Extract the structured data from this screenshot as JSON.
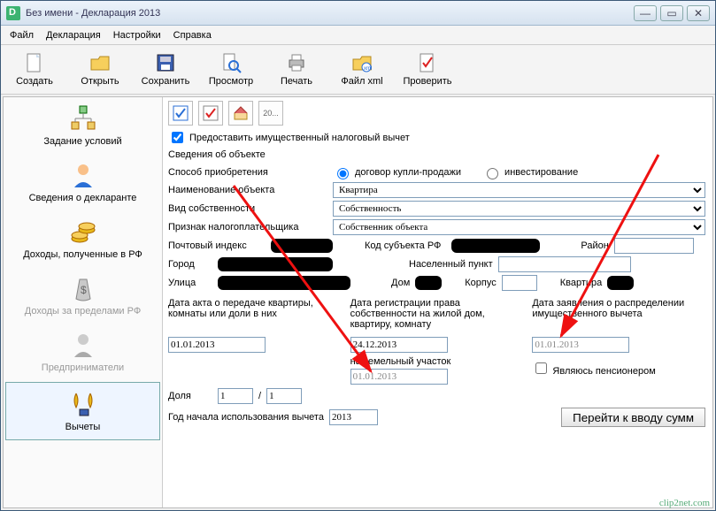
{
  "window": {
    "title": "Без имени - Декларация 2013"
  },
  "menu": {
    "file": "Файл",
    "decl": "Декларация",
    "settings": "Настройки",
    "help": "Справка"
  },
  "toolbar": {
    "create": "Создать",
    "open": "Открыть",
    "save": "Сохранить",
    "preview": "Просмотр",
    "print": "Печать",
    "xml": "Файл xml",
    "check": "Проверить"
  },
  "sidebar": {
    "conditions": "Задание условий",
    "declarant": "Сведения о декларанте",
    "income_rf": "Доходы, полученные в РФ",
    "income_foreign": "Доходы за пределами РФ",
    "entrepreneurs": "Предприниматели",
    "deductions": "Вычеты"
  },
  "content": {
    "grant_checkbox": "Предоставить имущественный налоговый вычет",
    "section_title": "Сведения об объекте",
    "labels": {
      "acq_method": "Способ приобретения",
      "obj_name": "Наименование объекта",
      "ownership_type": "Вид собственности",
      "taxpayer_sign": "Признак налогоплательщика",
      "postal": "Почтовый индекс",
      "subject_code": "Код субъекта РФ",
      "district": "Район",
      "city": "Город",
      "settlement": "Населенный пункт",
      "street": "Улица",
      "house": "Дом",
      "building": "Корпус",
      "flat": "Квартира",
      "date_act": "Дата акта о передаче квартиры, комнаты или доли в них",
      "date_reg": "Дата регистрации права собственности на жилой дом, квартиру, комнату",
      "land_sub": "на земельный участок",
      "date_appl": "Дата заявления о распределении имущественного вычета",
      "share": "Доля",
      "pensioner": "Являюсь пенсионером",
      "year_start": "Год начала использования вычета",
      "goto_sums": "Перейти к вводу сумм"
    },
    "radios": {
      "contract": "договор купли-продажи",
      "invest": "инвестирование"
    },
    "values": {
      "obj_name": "Квартира",
      "ownership_type": "Собственность",
      "taxpayer_sign": "Собственник объекта",
      "date_act": "01.01.2013",
      "date_reg": "24.12.2013",
      "date_land": "01.01.2013",
      "date_appl": "01.01.2013",
      "share_a": "1",
      "share_b": "1",
      "year_start": "2013"
    }
  },
  "subtoolbar": {
    "twenty": "20..."
  },
  "watermark": "clip2net.com"
}
